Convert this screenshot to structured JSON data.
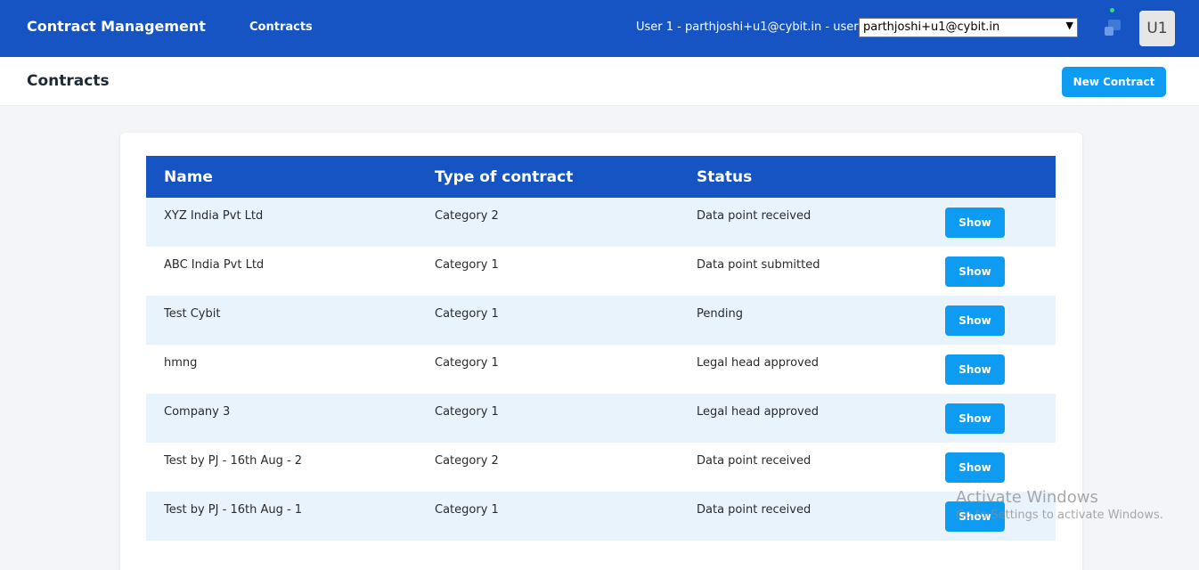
{
  "header": {
    "app_title": "Contract Management",
    "nav": [
      {
        "label": "Contracts"
      }
    ],
    "user_text": "User 1 - parthjoshi+u1@cybit.in - user",
    "user_select_value": "parthjoshi+u1@cybit.in",
    "avatar_initials": "U1"
  },
  "page": {
    "title": "Contracts",
    "new_button_label": "New Contract"
  },
  "table": {
    "columns": [
      "Name",
      "Type of contract",
      "Status"
    ],
    "show_label": "Show",
    "rows": [
      {
        "name": "XYZ India Pvt Ltd",
        "type": "Category 2",
        "status": "Data point received"
      },
      {
        "name": "ABC India Pvt Ltd",
        "type": "Category 1",
        "status": "Data point submitted"
      },
      {
        "name": "Test Cybit",
        "type": "Category 1",
        "status": "Pending"
      },
      {
        "name": "hmng",
        "type": "Category 1",
        "status": "Legal head approved"
      },
      {
        "name": "Company 3",
        "type": "Category 1",
        "status": "Legal head approved"
      },
      {
        "name": "Test by PJ - 16th Aug - 2",
        "type": "Category 2",
        "status": "Data point received"
      },
      {
        "name": "Test by PJ - 16th Aug - 1",
        "type": "Category 1",
        "status": "Data point received"
      }
    ]
  },
  "watermark": {
    "line1": "Activate Windows",
    "line2": "Go to Settings to activate Windows."
  },
  "colors": {
    "primary": "#1554c2",
    "button": "#0d9cf2",
    "row_alt": "#e9f3fb"
  }
}
